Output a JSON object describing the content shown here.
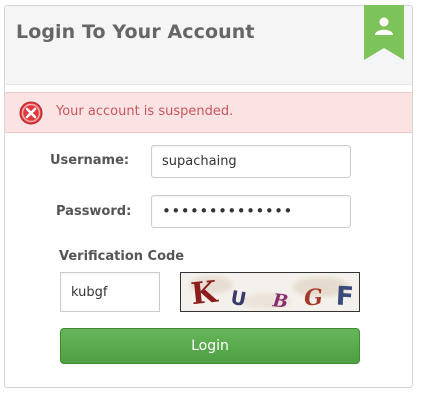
{
  "panel": {
    "title": "Login To Your Account"
  },
  "ribbon": {
    "icon": "user-icon",
    "color": "#7cc35a"
  },
  "alert": {
    "icon": "error-circle-x-icon",
    "message": "Your account is suspended.",
    "bg_color": "#fbe3e3",
    "text_color": "#c9555d"
  },
  "form": {
    "username_label": "Username:",
    "username_value": "supachaing",
    "password_label": "Password:",
    "password_value": "••••••••••••••",
    "verification_label": "Verification Code",
    "verification_value": "kubgf",
    "captcha_chars": [
      "K",
      "U",
      "B",
      "G",
      "F"
    ],
    "captcha_colors": [
      "#8b1d1d",
      "#3a3a6b",
      "#8a2d6d",
      "#a33a2a",
      "#3a4a7a"
    ],
    "login_label": "Login",
    "login_color": "#55a84a"
  }
}
